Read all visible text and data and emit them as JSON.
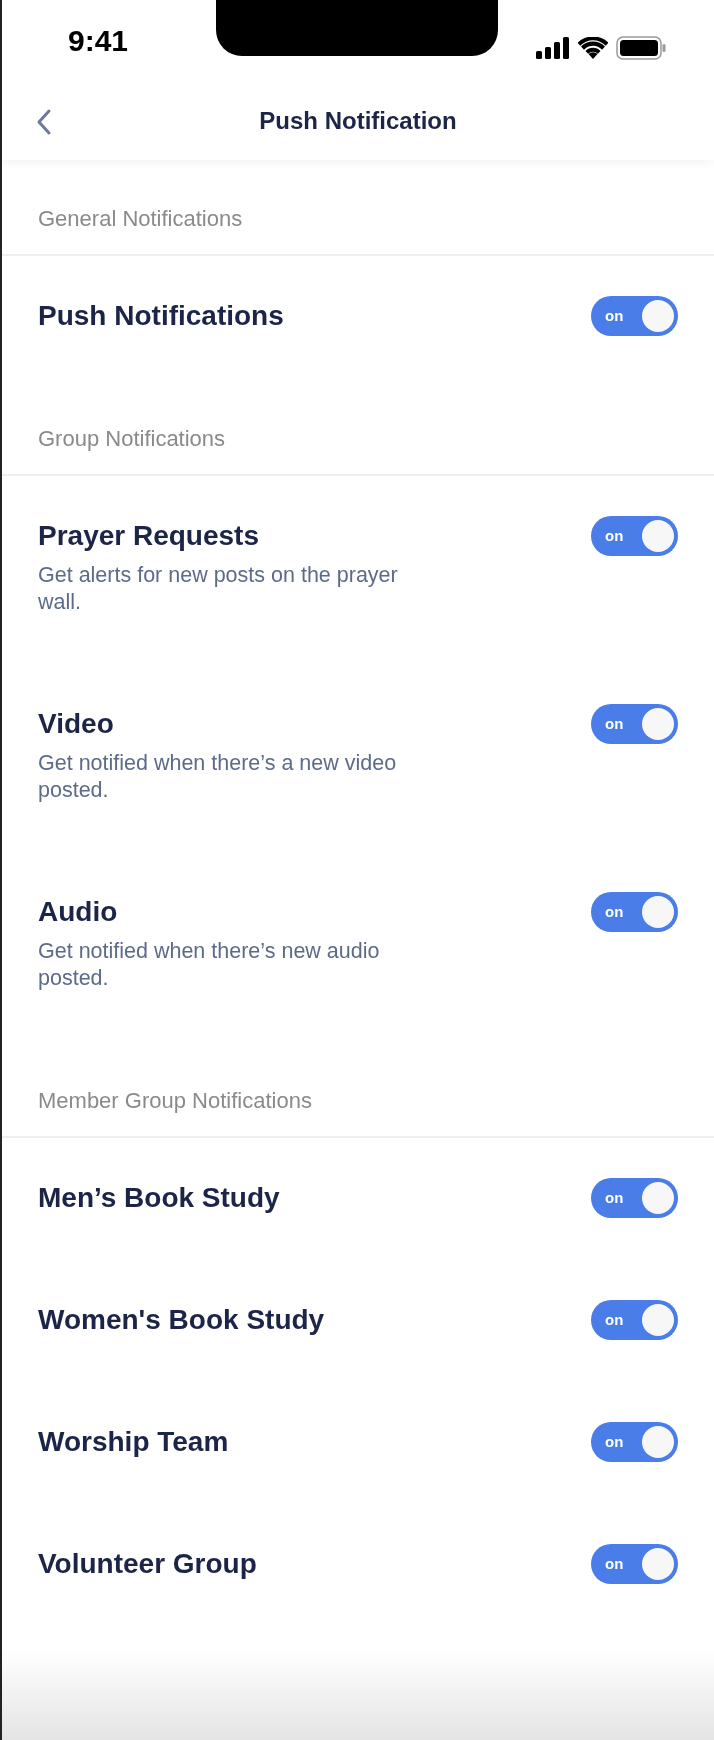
{
  "status_bar": {
    "time": "9:41"
  },
  "nav": {
    "title": "Push Notification"
  },
  "sections": [
    {
      "header": "General Notifications",
      "items": [
        {
          "title": "Push Notifications",
          "on": true,
          "toggle_text": "on"
        }
      ]
    },
    {
      "header": "Group Notifications",
      "items": [
        {
          "title": "Prayer Requests",
          "description": "Get alerts for new posts on the prayer wall.",
          "on": true,
          "toggle_text": "on"
        },
        {
          "title": "Video",
          "description": "Get notified when there’s a new video posted.",
          "on": true,
          "toggle_text": "on"
        },
        {
          "title": "Audio",
          "description": "Get notified when there’s new audio posted.",
          "on": true,
          "toggle_text": "on"
        }
      ]
    },
    {
      "header": "Member Group Notifications",
      "items": [
        {
          "title": "Men’s Book Study",
          "on": true,
          "toggle_text": "on"
        },
        {
          "title": "Women's Book Study",
          "on": true,
          "toggle_text": "on"
        },
        {
          "title": "Worship Team",
          "on": true,
          "toggle_text": "on"
        },
        {
          "title": "Volunteer Group",
          "on": true,
          "toggle_text": "on"
        }
      ]
    }
  ]
}
